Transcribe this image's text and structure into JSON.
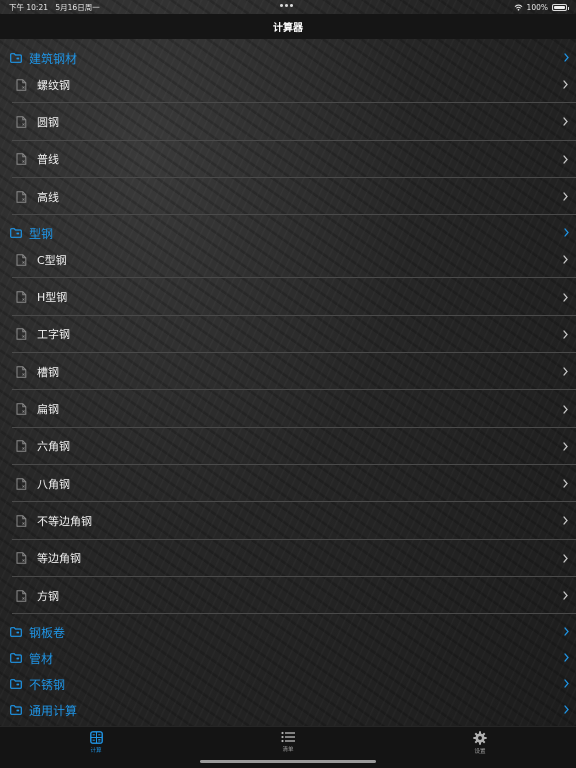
{
  "status_bar": {
    "time": "下午 10:21",
    "date": "5月16日周一",
    "battery": "100%"
  },
  "nav": {
    "title": "计算器"
  },
  "colors": {
    "accent": "#1f95e6",
    "background": "#1b1b1b",
    "separator": "#4a4a4a"
  },
  "sections": [
    {
      "title": "建筑钢材",
      "items": [
        "螺纹钢",
        "圆钢",
        "普线",
        "高线"
      ]
    },
    {
      "title": "型钢",
      "items": [
        "C型钢",
        "H型钢",
        "工字钢",
        "槽钢",
        "扁钢",
        "六角钢",
        "八角钢",
        "不等边角钢",
        "等边角钢",
        "方钢"
      ]
    },
    {
      "title": "钢板卷",
      "items": []
    },
    {
      "title": "管材",
      "items": []
    },
    {
      "title": "不锈钢",
      "items": []
    },
    {
      "title": "通用计算",
      "items": []
    }
  ],
  "tabs": [
    {
      "label": "计算",
      "icon": "calculator-icon",
      "active": true
    },
    {
      "label": "清单",
      "icon": "list-icon",
      "active": false
    },
    {
      "label": "设置",
      "icon": "gear-icon",
      "active": false
    }
  ]
}
